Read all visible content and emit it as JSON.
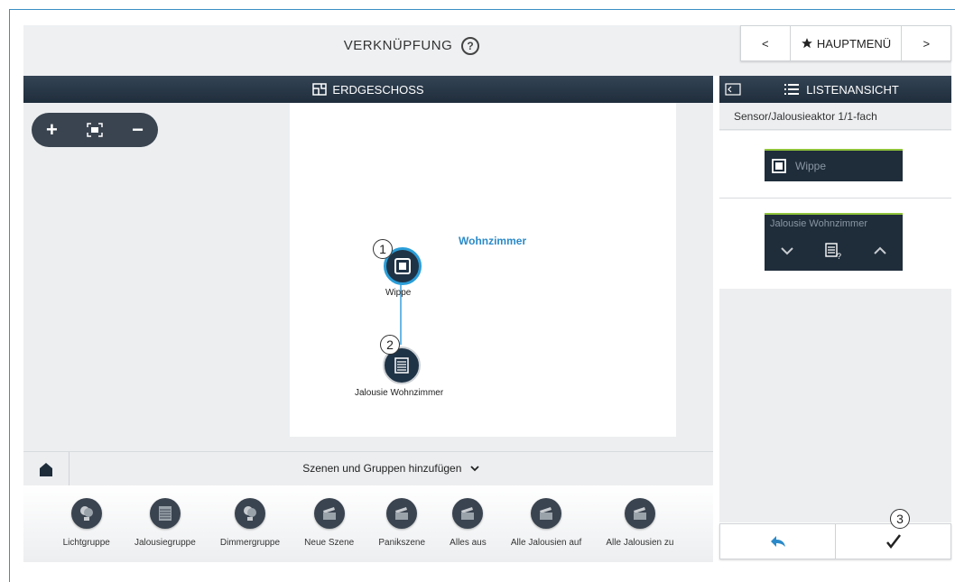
{
  "header": {
    "title": "VERKNÜPFUNG",
    "help_icon": "?",
    "nav": {
      "prev": "<",
      "menu": "HAUPTMENÜ",
      "next": ">"
    }
  },
  "floor_bar": {
    "label": "ERDGESCHOSS"
  },
  "list_bar": {
    "label": "LISTENANSICHT"
  },
  "map": {
    "room": "Wohnzimmer",
    "nodes": [
      {
        "label": "Wippe",
        "marker": "1"
      },
      {
        "label": "Jalousie Wohnzimmer",
        "marker": "2"
      }
    ]
  },
  "scene_bar": {
    "label": "Szenen und Gruppen hinzufügen"
  },
  "tray": [
    {
      "label": "Lichtgruppe",
      "icon": "bulb-icon"
    },
    {
      "label": "Jalousiegruppe",
      "icon": "blind-icon"
    },
    {
      "label": "Dimmergruppe",
      "icon": "bulb-icon"
    },
    {
      "label": "Neue Szene",
      "icon": "clapper-icon"
    },
    {
      "label": "Panikszene",
      "icon": "clapper-icon"
    },
    {
      "label": "Alles aus",
      "icon": "clapper-icon"
    },
    {
      "label": "Alle Jalousien auf",
      "icon": "clapper-icon"
    },
    {
      "label": "Alle Jalousien zu",
      "icon": "clapper-icon"
    }
  ],
  "panel": {
    "title": "Sensor/Jalousieaktor 1/1-fach",
    "chip1": "Wippe",
    "chip2": "Jalousie Wohnzimmer"
  },
  "footer": {
    "marker": "3"
  },
  "colors": {
    "accent": "#2a8ac9",
    "dark": "#1f2d3b",
    "active": "#8fc43a"
  }
}
